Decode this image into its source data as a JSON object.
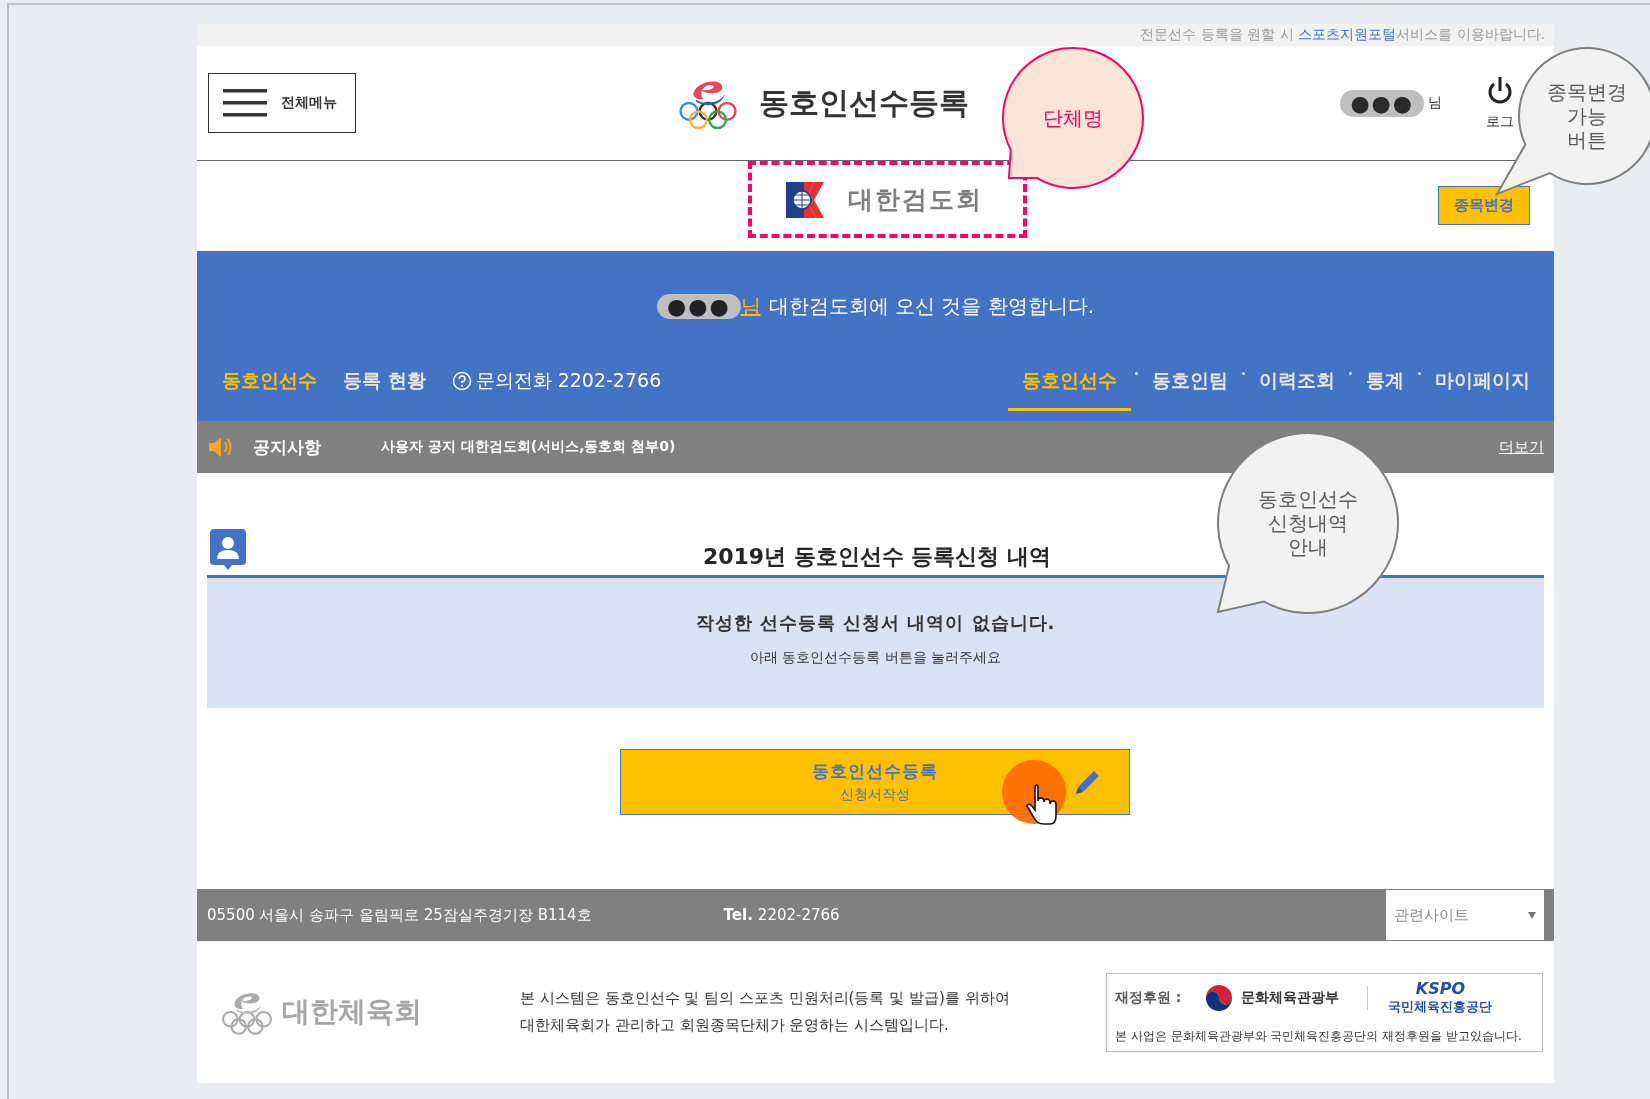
{
  "top_notice": {
    "before": "전문선수 등록을 원할 시 ",
    "link": "스포츠지원포털",
    "after": "서비스를 이용바랍니다."
  },
  "header": {
    "menu_button": "전체메뉴",
    "title": "동호인선수등록",
    "user_name": "●●●",
    "user_suffix": "님",
    "logout": "로그"
  },
  "organization": {
    "name": "대한검도회",
    "highlighted": true,
    "change_button": "종목변경"
  },
  "welcome": {
    "name": "●●●",
    "suffix": "님",
    "message": "대한검도회에 오신 것을 환영합니다."
  },
  "left_nav": [
    {
      "label": "동호인선수",
      "selected": true
    },
    {
      "label": "등록 현황",
      "selected": false
    }
  ],
  "phone": "문의전화 2202-2766",
  "main_nav": [
    {
      "label": "동호인선수",
      "selected": true
    },
    {
      "label": "동호인팀",
      "selected": false
    },
    {
      "label": "이력조회",
      "selected": false
    },
    {
      "label": "통계",
      "selected": false
    },
    {
      "label": "마이페이지",
      "selected": false
    }
  ],
  "notice_bar": {
    "label": "공지사항",
    "text": "사용자 공지 대한검도회(서비스,동호회 첨부0)",
    "more": "더보기"
  },
  "section": {
    "title": "2019년 동호인선수 등록신청 내역",
    "empty_message": "작성한 선수등록 신청서 내역이 없습니다.",
    "hint": "아래 동호인선수등록 버튼을 눌러주세요"
  },
  "register_button": {
    "title": "동호인선수등록",
    "subtitle": "신청서작성"
  },
  "footer": {
    "address": "05500 서울시 송파구 올림픽로 25잠실주경기장 B114호",
    "tel_label": "Tel.",
    "tel": "2202-2766",
    "related_sites": "관련사이트",
    "logo_text": "대한체육회",
    "description": "본 시스템은 동호인선수 및 팀의 스포츠 민원처리(등록 및 발급)를 위하여\n대한체육회가 관리하고 회원종목단체가 운영하는 시스템입니다.",
    "sponsor_label": "재정후원 :",
    "ministry": "문화체육관광부",
    "kspo_logo": "KSPO",
    "kspo_name": "국민체육진흥공단",
    "sponsor_note": "본 사업은 문화체육관광부와 국민체육진흥공단의 재정후원을 받고있습니다."
  },
  "callouts": [
    {
      "kind": "highlight",
      "text": "단체명"
    },
    {
      "kind": "info",
      "text": "종목변경\n가능\n버튼"
    },
    {
      "kind": "info",
      "text": "동호인선수\n신청내역\n안내"
    }
  ]
}
